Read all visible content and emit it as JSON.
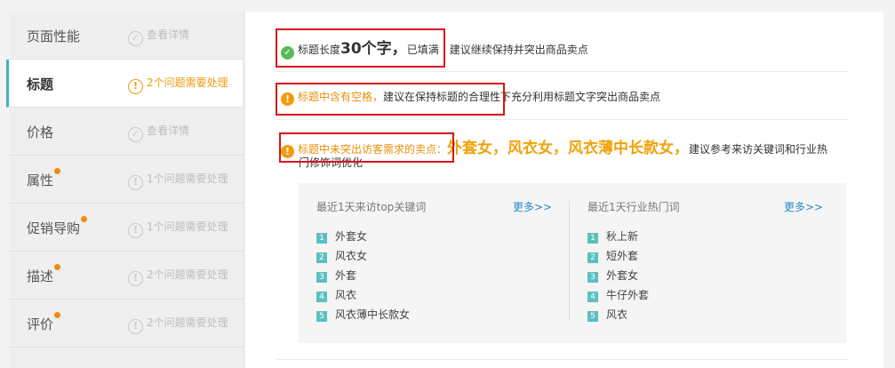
{
  "sidebar": {
    "items": [
      {
        "name": "页面性能",
        "status": "查看详情",
        "icon": "check-circle-icon",
        "dot": false,
        "active": false
      },
      {
        "name": "标题",
        "status": "2个问题需要处理",
        "icon": "warning-circle-icon",
        "dot": false,
        "active": true
      },
      {
        "name": "价格",
        "status": "查看详情",
        "icon": "check-circle-icon",
        "dot": false,
        "active": false
      },
      {
        "name": "属性",
        "status": "1个问题需要处理",
        "icon": "warning-circle-icon",
        "dot": true,
        "active": false
      },
      {
        "name": "促销导购",
        "status": "1个问题需要处理",
        "icon": "warning-circle-icon",
        "dot": true,
        "active": false
      },
      {
        "name": "描述",
        "status": "2个问题需要处理",
        "icon": "warning-circle-icon",
        "dot": true,
        "active": false
      },
      {
        "name": "评价",
        "status": "2个问题需要处理",
        "icon": "warning-circle-icon",
        "dot": true,
        "active": false
      }
    ]
  },
  "main": {
    "row1": {
      "prefix": "标题长度",
      "big": "30个字，",
      "suffix": "已填满",
      "advice": "建议继续保持并突出商品卖点"
    },
    "row2": {
      "warn": "标题中含有空格，",
      "advice": "建议在保持标题的合理性下充分利用标题文字突出商品卖点"
    },
    "row3": {
      "warn": "标题中未突出访客需求的卖点：",
      "keywords": "外套女，风衣女，风衣薄中长款女，",
      "advice_line1": "建议参考来访关键词和行业热",
      "advice_line2": "门修饰词优化"
    },
    "panel": {
      "left": {
        "title": "最近1天来访top关键词",
        "more": "更多>>",
        "items": [
          "外套女",
          "风衣女",
          "外套",
          "风衣",
          "风衣薄中长款女"
        ]
      },
      "right": {
        "title": "最近1天行业热门词",
        "more": "更多>>",
        "items": [
          "秋上新",
          "短外套",
          "外套女",
          "牛仔外套",
          "风衣"
        ]
      }
    }
  },
  "colors": {
    "accent": "#3fb6b6",
    "warning": "#f29b0e",
    "ok": "#5cb85c",
    "annotation": "#d9141a",
    "link": "#2a87c8"
  }
}
